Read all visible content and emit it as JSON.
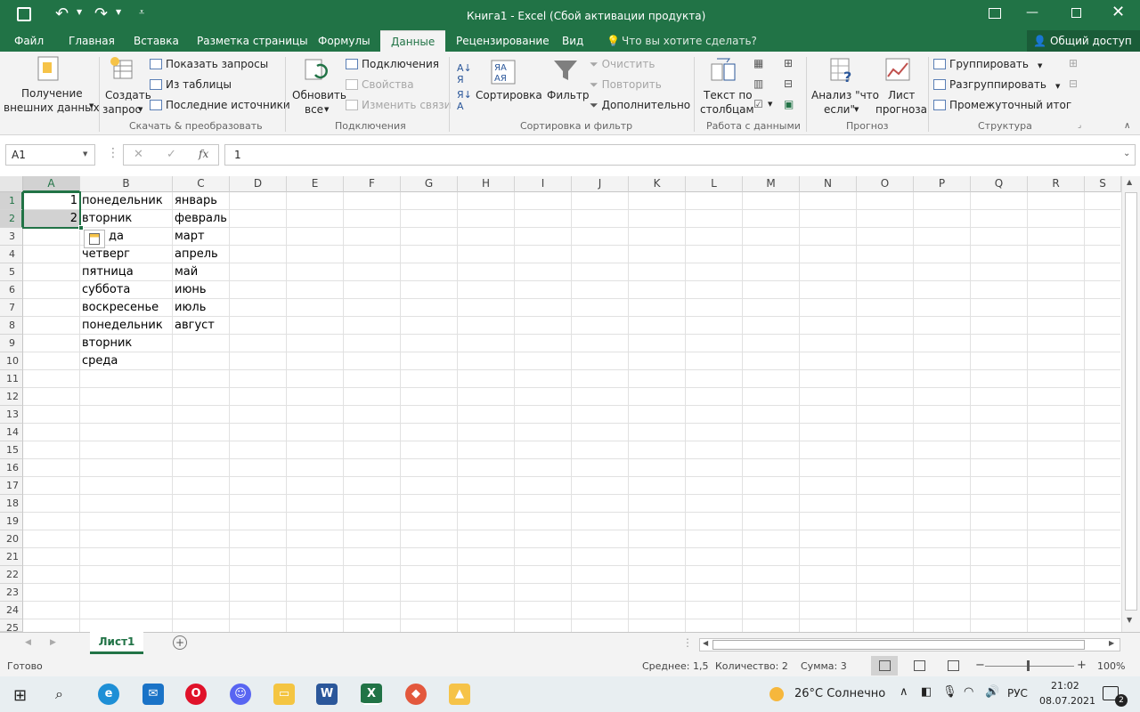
{
  "window": {
    "title": "Книга1 - Excel (Сбой активации продукта)"
  },
  "qat": {
    "save": "save-icon",
    "undo": "undo-icon",
    "redo": "redo-icon",
    "customize": "customize-icon"
  },
  "tabs": [
    "Файл",
    "Главная",
    "Вставка",
    "Разметка страницы",
    "Формулы",
    "Данные",
    "Рецензирование",
    "Вид"
  ],
  "active_tab": "Данные",
  "tell_me": "Что вы хотите сделать?",
  "share": "Общий доступ",
  "ribbon": {
    "get_external": [
      "Получение",
      "внешних данных"
    ],
    "create_query": [
      "Создать",
      "запрос"
    ],
    "show_queries": "Показать запросы",
    "from_table": "Из таблицы",
    "recent_sources": "Последние источники",
    "group_get": "Скачать & преобразовать",
    "refresh_all": [
      "Обновить",
      "все"
    ],
    "connections": "Подключения",
    "properties": "Свойства",
    "edit_links": "Изменить связи",
    "group_connections": "Подключения",
    "sort": "Сортировка",
    "filter": "Фильтр",
    "clear": "Очистить",
    "reapply": "Повторить",
    "advanced": "Дополнительно",
    "group_sort": "Сортировка и фильтр",
    "text_to_columns": [
      "Текст по",
      "столбцам"
    ],
    "group_data_tools": "Работа с данными",
    "what_if": [
      "Анализ \"что",
      "если\""
    ],
    "forecast": [
      "Лист",
      "прогноза"
    ],
    "group_forecast": "Прогноз",
    "group": "Группировать",
    "ungroup": "Разгруппировать",
    "subtotal": "Промежуточный итог",
    "group_outline": "Структура"
  },
  "formula_bar": {
    "name_box": "A1",
    "formula": "1",
    "fx": "fx"
  },
  "columns": [
    "A",
    "B",
    "C",
    "D",
    "E",
    "F",
    "G",
    "H",
    "I",
    "J",
    "K",
    "L",
    "M",
    "N",
    "O",
    "P",
    "Q",
    "R",
    "S"
  ],
  "rows": [
    "1",
    "2",
    "3",
    "4",
    "5",
    "6",
    "7",
    "8",
    "9",
    "10",
    "11",
    "12",
    "13",
    "14",
    "15",
    "16",
    "17",
    "18",
    "19",
    "20",
    "21",
    "22",
    "23",
    "24",
    "25"
  ],
  "cells": {
    "A1": "1",
    "A2": "2",
    "B1": "понедельник",
    "B2": "вторник",
    "B3": "да",
    "B4": "четверг",
    "B5": "пятница",
    "B6": "суббота",
    "B7": "воскресенье",
    "B8": "понедельник",
    "B9": "вторник",
    "B10": "среда",
    "C1": "январь",
    "C2": "февраль",
    "C3": "март",
    "C4": "апрель",
    "C5": "май",
    "C6": "июнь",
    "C7": "июль",
    "C8": "август"
  },
  "sheets": [
    "Лист1"
  ],
  "status": {
    "ready": "Готово",
    "average": "Среднее: 1,5",
    "count": "Количество: 2",
    "sum": "Сумма: 3",
    "zoom": "100%"
  },
  "taskbar": {
    "weather": "26°C  Солнечно",
    "lang": "РУС",
    "time": "21:02",
    "date": "08.07.2021",
    "notifications": "2"
  },
  "colors": {
    "accent": "#217346",
    "selection": "#d2d2d2"
  }
}
